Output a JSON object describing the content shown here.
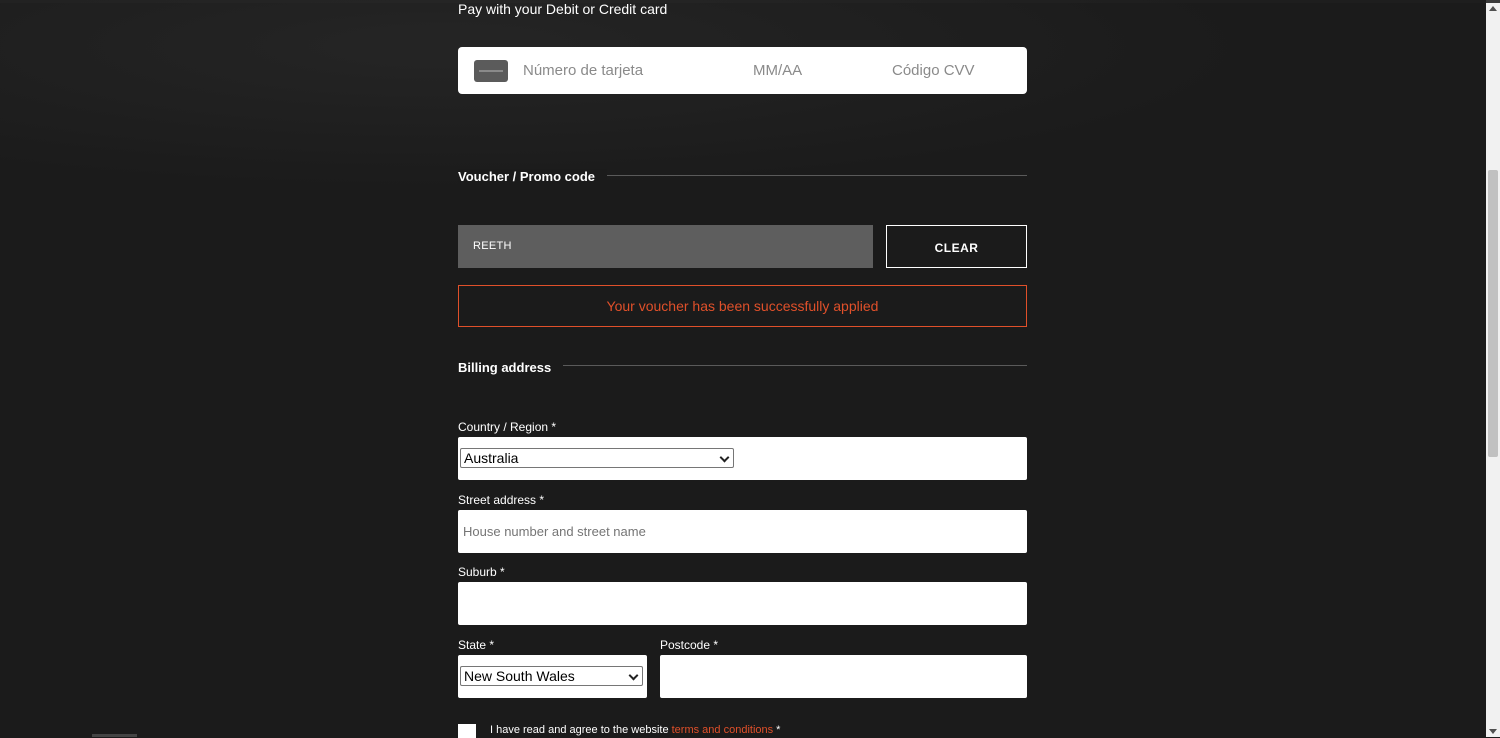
{
  "payment": {
    "heading": "Pay with your Debit or Credit card",
    "card_icon": "credit-card-icon",
    "card_number_placeholder": "Número de tarjeta",
    "expiry_placeholder": "MM/AA",
    "cvv_placeholder": "Código CVV"
  },
  "voucher": {
    "title": "Voucher / Promo code",
    "code_value": "REETH",
    "clear_label": "CLEAR",
    "success_message": "Your voucher has been successfully applied"
  },
  "billing": {
    "title": "Billing address",
    "country_label": "Country / Region *",
    "country_value": "Australia",
    "street_label": "Street address *",
    "street_placeholder": "House number and street name",
    "suburb_label": "Suburb *",
    "suburb_value": "",
    "state_label": "State *",
    "state_value": "New South Wales",
    "postcode_label": "Postcode *",
    "postcode_value": ""
  },
  "terms": {
    "text_before": "I have read and agree to the website ",
    "link_text": "terms and conditions",
    "text_after": " *"
  },
  "colors": {
    "background": "#1b1b1b",
    "accent": "#e0502a",
    "voucher_field": "#5e5e5e"
  }
}
